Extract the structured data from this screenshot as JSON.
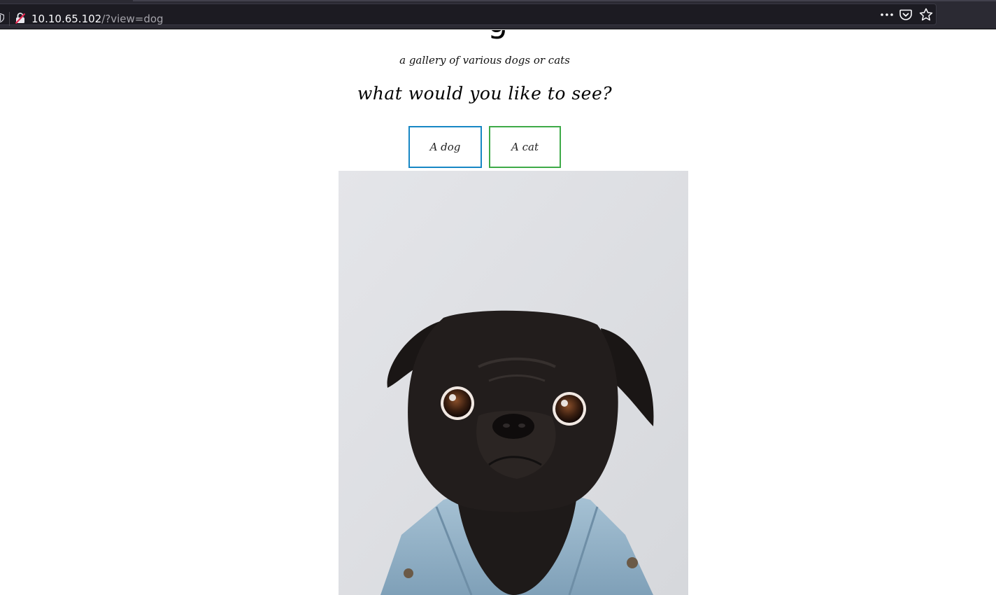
{
  "browser": {
    "url_host": "10.10.65.102",
    "url_path": "/?view=dog",
    "icons": [
      "shield-icon",
      "insecure-lock-icon",
      "page-actions-menu-icon",
      "pocket-icon",
      "bookmark-star-icon"
    ]
  },
  "page": {
    "heading_visible_fragment": "g",
    "subtitle": "a gallery of various dogs or cats",
    "question": "what would you like to see?",
    "buttons": {
      "dog": "A dog",
      "cat": "A cat"
    },
    "image": {
      "subject": "black pug wearing a denim jacket"
    }
  },
  "colors": {
    "dog_button_border": "#1787c4",
    "cat_button_border": "#3eaa48",
    "toolbar_bg": "#2b2a33",
    "urlbar_bg": "#1c1b22"
  }
}
